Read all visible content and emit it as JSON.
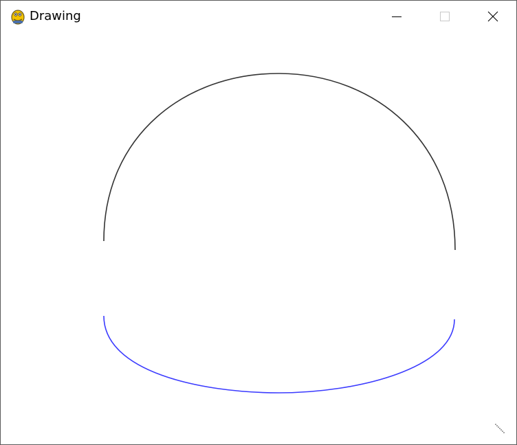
{
  "window": {
    "title": "Drawing",
    "app_icon": "pygame-snake-icon",
    "controls": {
      "minimize": "minimize-icon",
      "maximize": "maximize-icon",
      "close": "close-icon"
    }
  },
  "canvas": {
    "background": "#ffffff",
    "arcs": [
      {
        "name": "upper-arc",
        "color": "#333333"
      },
      {
        "name": "lower-arc",
        "color": "#3b3bff"
      }
    ]
  }
}
